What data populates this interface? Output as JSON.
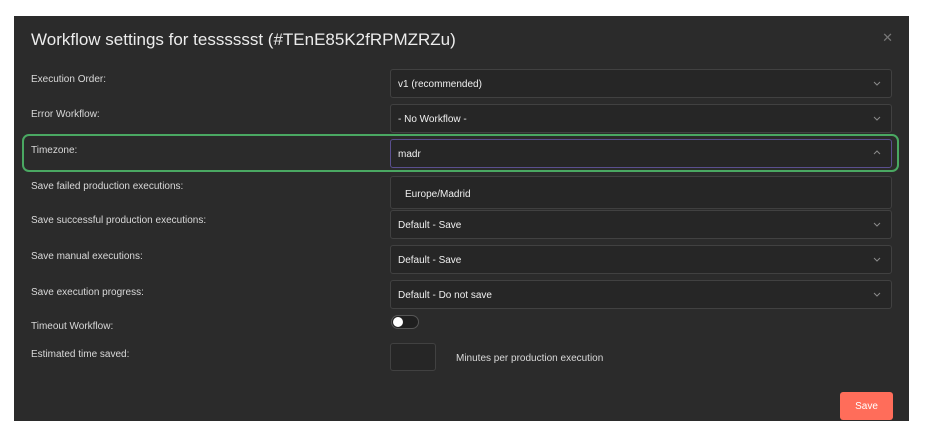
{
  "modal": {
    "title": "Workflow settings for tesssssst (#TEnE85K2fRPMZRZu)",
    "close_icon": "close-icon"
  },
  "fields": {
    "execution_order": {
      "label": "Execution Order:",
      "value": "v1 (recommended)"
    },
    "error_workflow": {
      "label": "Error Workflow:",
      "value": "- No Workflow -"
    },
    "timezone": {
      "label": "Timezone:",
      "value": "madr",
      "options": [
        "Europe/Madrid"
      ]
    },
    "save_failed": {
      "label": "Save failed production executions:"
    },
    "save_successful": {
      "label": "Save successful production executions:",
      "value": "Default - Save"
    },
    "save_manual": {
      "label": "Save manual executions:",
      "value": "Default - Save"
    },
    "save_progress": {
      "label": "Save execution progress:",
      "value": "Default - Do not save"
    },
    "timeout": {
      "label": "Timeout Workflow:",
      "enabled": false
    },
    "time_saved": {
      "label": "Estimated time saved:",
      "value": "",
      "suffix": "Minutes per production execution"
    }
  },
  "footer": {
    "save_label": "Save"
  },
  "colors": {
    "accent": "#ff6d5a",
    "highlight": "#4aa862",
    "background": "#2b2b2b"
  }
}
